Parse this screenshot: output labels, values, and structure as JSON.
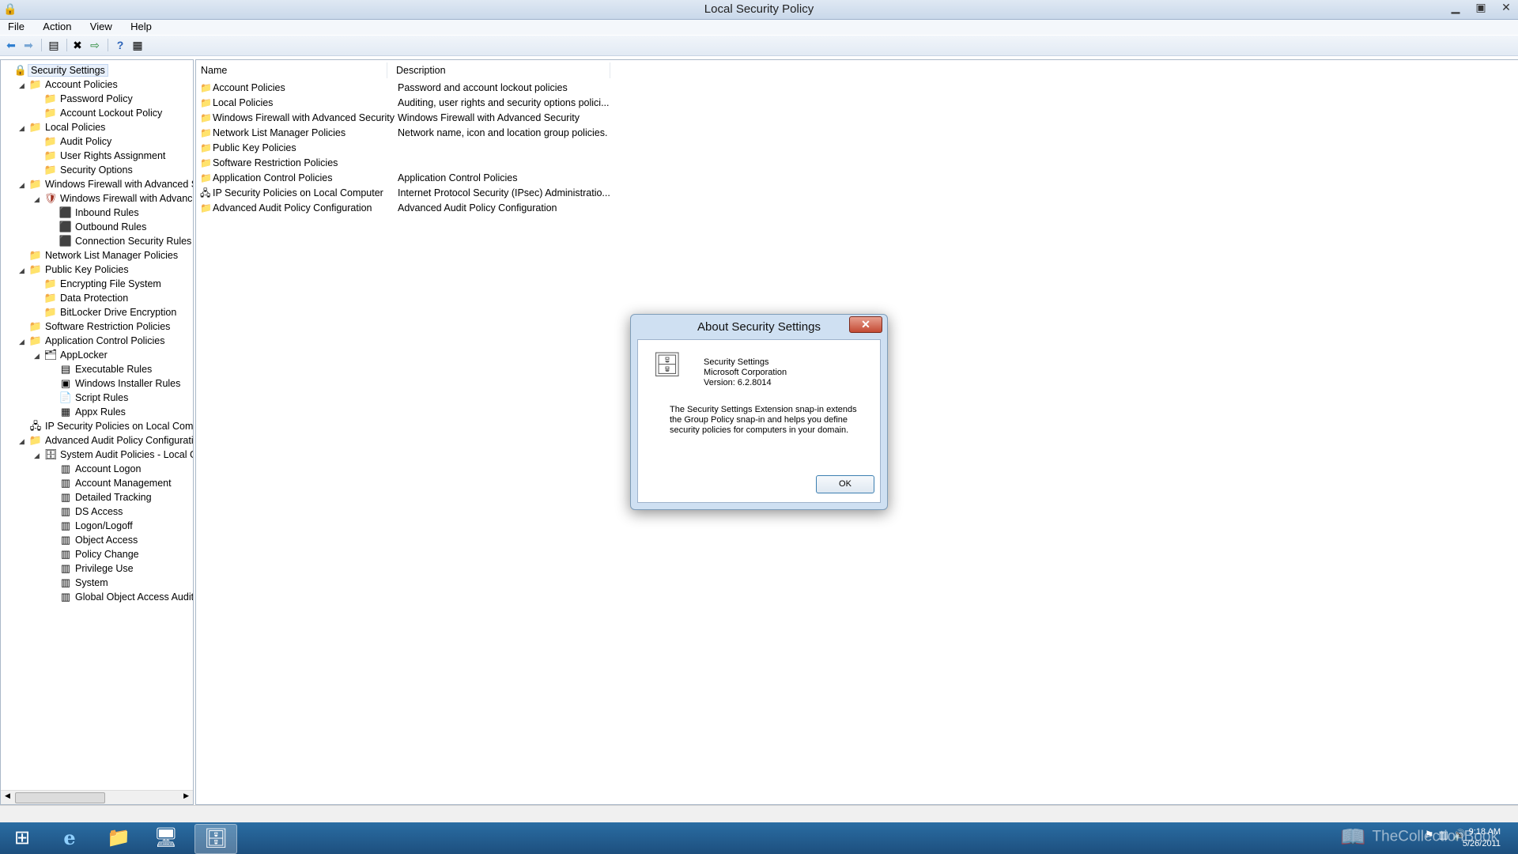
{
  "window": {
    "title": "Local Security Policy"
  },
  "menu": [
    "File",
    "Action",
    "View",
    "Help"
  ],
  "tree": [
    {
      "label": "Security Settings",
      "depth": 0,
      "arrow": "",
      "icon": "settings-icon",
      "selected": true
    },
    {
      "label": "Account Policies",
      "depth": 1,
      "arrow": "◢",
      "icon": "folder-lock-icon"
    },
    {
      "label": "Password Policy",
      "depth": 2,
      "arrow": "",
      "icon": "folder-lock-icon"
    },
    {
      "label": "Account Lockout Policy",
      "depth": 2,
      "arrow": "",
      "icon": "folder-lock-icon"
    },
    {
      "label": "Local Policies",
      "depth": 1,
      "arrow": "◢",
      "icon": "folder-lock-icon"
    },
    {
      "label": "Audit Policy",
      "depth": 2,
      "arrow": "",
      "icon": "folder-lock-icon"
    },
    {
      "label": "User Rights Assignment",
      "depth": 2,
      "arrow": "",
      "icon": "folder-lock-icon"
    },
    {
      "label": "Security Options",
      "depth": 2,
      "arrow": "",
      "icon": "folder-lock-icon"
    },
    {
      "label": "Windows Firewall with Advanced Secu",
      "depth": 1,
      "arrow": "◢",
      "icon": "folder-icon"
    },
    {
      "label": "Windows Firewall with Advanced",
      "depth": 2,
      "arrow": "◢",
      "icon": "firewall-icon"
    },
    {
      "label": "Inbound Rules",
      "depth": 3,
      "arrow": "",
      "icon": "inbound-rules-icon"
    },
    {
      "label": "Outbound Rules",
      "depth": 3,
      "arrow": "",
      "icon": "outbound-rules-icon"
    },
    {
      "label": "Connection Security Rules",
      "depth": 3,
      "arrow": "",
      "icon": "connection-rules-icon"
    },
    {
      "label": "Network List Manager Policies",
      "depth": 1,
      "arrow": "",
      "icon": "folder-icon"
    },
    {
      "label": "Public Key Policies",
      "depth": 1,
      "arrow": "◢",
      "icon": "folder-icon"
    },
    {
      "label": "Encrypting File System",
      "depth": 2,
      "arrow": "",
      "icon": "folder-icon"
    },
    {
      "label": "Data Protection",
      "depth": 2,
      "arrow": "",
      "icon": "folder-icon"
    },
    {
      "label": "BitLocker Drive Encryption",
      "depth": 2,
      "arrow": "",
      "icon": "folder-icon"
    },
    {
      "label": "Software Restriction Policies",
      "depth": 1,
      "arrow": "",
      "icon": "folder-icon"
    },
    {
      "label": "Application Control Policies",
      "depth": 1,
      "arrow": "◢",
      "icon": "folder-icon"
    },
    {
      "label": "AppLocker",
      "depth": 2,
      "arrow": "◢",
      "icon": "applocker-icon"
    },
    {
      "label": "Executable Rules",
      "depth": 3,
      "arrow": "",
      "icon": "rules-icon"
    },
    {
      "label": "Windows Installer Rules",
      "depth": 3,
      "arrow": "",
      "icon": "installer-icon"
    },
    {
      "label": "Script Rules",
      "depth": 3,
      "arrow": "",
      "icon": "script-icon"
    },
    {
      "label": "Appx Rules",
      "depth": 3,
      "arrow": "",
      "icon": "appx-icon"
    },
    {
      "label": "IP Security Policies on Local Compute",
      "depth": 1,
      "arrow": "",
      "icon": "ipsec-icon"
    },
    {
      "label": "Advanced Audit Policy Configuration",
      "depth": 1,
      "arrow": "◢",
      "icon": "folder-icon"
    },
    {
      "label": "System Audit Policies - Local Grou",
      "depth": 2,
      "arrow": "◢",
      "icon": "audit-icon"
    },
    {
      "label": "Account Logon",
      "depth": 3,
      "arrow": "",
      "icon": "audit-item-icon"
    },
    {
      "label": "Account Management",
      "depth": 3,
      "arrow": "",
      "icon": "audit-item-icon"
    },
    {
      "label": "Detailed Tracking",
      "depth": 3,
      "arrow": "",
      "icon": "audit-item-icon"
    },
    {
      "label": "DS Access",
      "depth": 3,
      "arrow": "",
      "icon": "audit-item-icon"
    },
    {
      "label": "Logon/Logoff",
      "depth": 3,
      "arrow": "",
      "icon": "audit-item-icon"
    },
    {
      "label": "Object Access",
      "depth": 3,
      "arrow": "",
      "icon": "audit-item-icon"
    },
    {
      "label": "Policy Change",
      "depth": 3,
      "arrow": "",
      "icon": "audit-item-icon"
    },
    {
      "label": "Privilege Use",
      "depth": 3,
      "arrow": "",
      "icon": "audit-item-icon"
    },
    {
      "label": "System",
      "depth": 3,
      "arrow": "",
      "icon": "audit-item-icon"
    },
    {
      "label": "Global Object Access Auditing",
      "depth": 3,
      "arrow": "",
      "icon": "audit-item-icon"
    }
  ],
  "list": {
    "columns": [
      "Name",
      "Description"
    ],
    "rows": [
      {
        "name": "Account Policies",
        "desc": "Password and account lockout policies",
        "icon": "folder-lock-icon"
      },
      {
        "name": "Local Policies",
        "desc": "Auditing, user rights and security options polici...",
        "icon": "folder-lock-icon"
      },
      {
        "name": "Windows Firewall with Advanced Security",
        "desc": "Windows Firewall with Advanced Security",
        "icon": "folder-icon"
      },
      {
        "name": "Network List Manager Policies",
        "desc": "Network name, icon and location group policies.",
        "icon": "folder-icon"
      },
      {
        "name": "Public Key Policies",
        "desc": "",
        "icon": "folder-icon"
      },
      {
        "name": "Software Restriction Policies",
        "desc": "",
        "icon": "folder-icon"
      },
      {
        "name": "Application Control Policies",
        "desc": "Application Control Policies",
        "icon": "folder-icon"
      },
      {
        "name": "IP Security Policies on Local Computer",
        "desc": "Internet Protocol Security (IPsec) Administratio...",
        "icon": "ipsec-icon"
      },
      {
        "name": "Advanced Audit Policy Configuration",
        "desc": "Advanced Audit Policy Configuration",
        "icon": "folder-icon"
      }
    ]
  },
  "dialog": {
    "title": "About Security Settings",
    "product": "Security Settings",
    "company": "Microsoft Corporation",
    "version": "Version: 6.2.8014",
    "description": "The Security Settings Extension snap-in extends the Group Policy snap-in and helps you define security policies for computers in your domain.",
    "ok": "OK"
  },
  "taskbar": {
    "time": "9:18 AM",
    "date": "5/26/2011",
    "watermark": "TheCollectionBook"
  }
}
